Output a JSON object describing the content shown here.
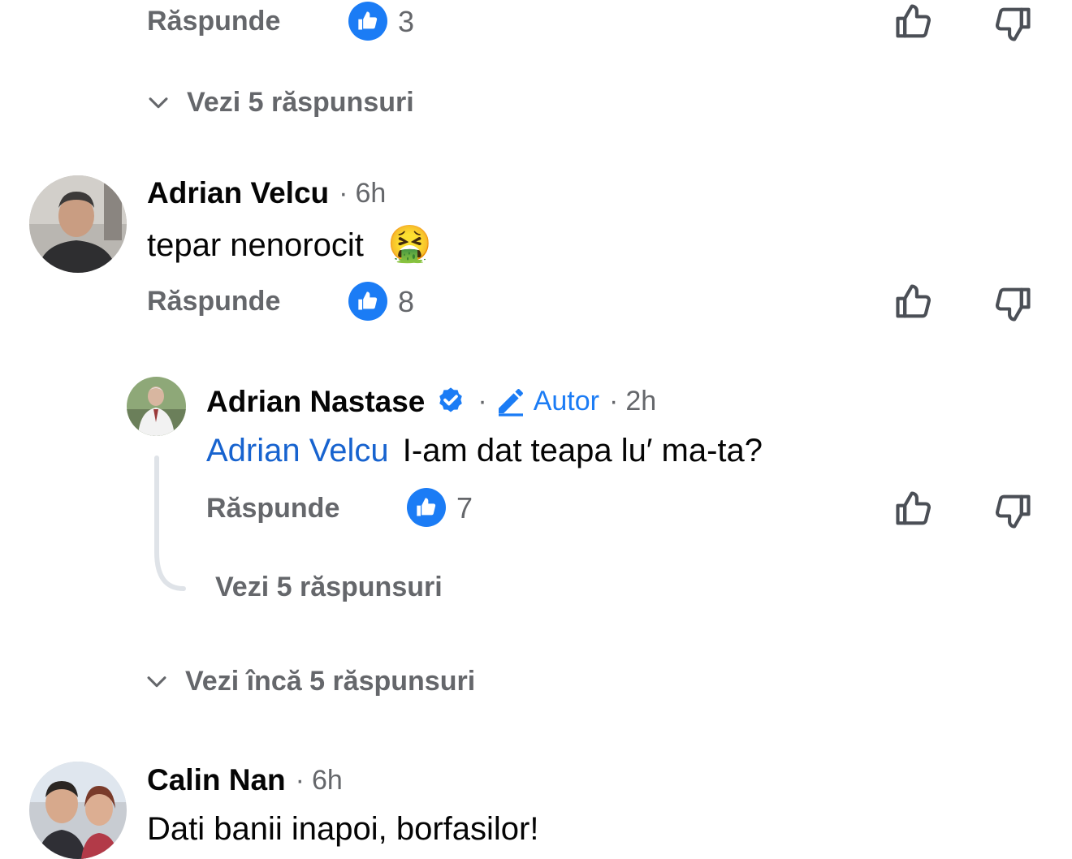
{
  "top_comment": {
    "reply_label": "Răspunde",
    "likes": "3",
    "see_replies_label": "Vezi 5 răspunsuri"
  },
  "comment_velcu": {
    "author": "Adrian Velcu",
    "time": "6h",
    "text": "tepar nenorocit",
    "emoji": "🤮",
    "reply_label": "Răspunde",
    "likes": "8"
  },
  "reply_nastase": {
    "author": "Adrian Nastase",
    "author_label": "Autor",
    "time": "2h",
    "mention": "Adrian Velcu",
    "text": "I-am dat teapa lu′ ma-ta?",
    "reply_label": "Răspunde",
    "likes": "7",
    "see_replies_label": "Vezi 5 răspunsuri"
  },
  "more_replies_label": "Vezi încă 5 răspunsuri",
  "comment_nan": {
    "author": "Calin Nan",
    "time": "6h",
    "text": "Dati banii inapoi, borfasilor!"
  },
  "separator": "·",
  "colors": {
    "accent": "#1b7cf5",
    "link": "#1763cf",
    "muted": "#65676b"
  }
}
